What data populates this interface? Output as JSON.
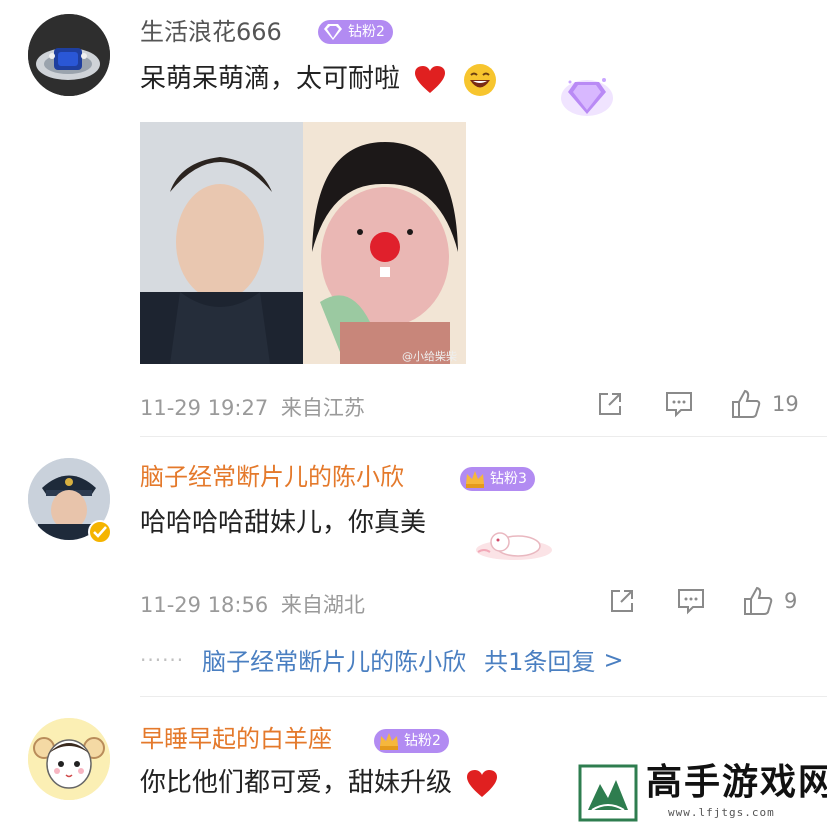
{
  "comments": [
    {
      "username": "生活浪花666",
      "badge": "钻粉2",
      "text": "呆萌呆萌滴，太可耐啦",
      "time": "11-29 19:27",
      "location": "来自江苏",
      "likes": "19"
    },
    {
      "username": "脑子经常断片儿的陈小欣",
      "badge": "钻粉3",
      "text": "哈哈哈哈甜妹儿，你真美",
      "time": "11-29 18:56",
      "location": "来自湖北",
      "likes": "9",
      "reply": {
        "dots": "······",
        "author": "脑子经常断片儿的陈小欣",
        "summary": "共1条回复",
        "arrow": ">"
      }
    },
    {
      "username": "早睡早起的白羊座",
      "badge": "钻粉2",
      "text": "你比他们都可爱，甜妹升级"
    }
  ],
  "image_watermark": "@小给柴柴",
  "watermark": {
    "text": "高手游戏网",
    "url": "www.lfjtgs.com"
  },
  "colors": {
    "username": "#e4792b",
    "username_first": "#555555",
    "badge_purple": "#b28bf2",
    "badge_gold": "#d8a25a",
    "reply_link": "#4a7fc1",
    "meta": "#9a9a9a"
  }
}
